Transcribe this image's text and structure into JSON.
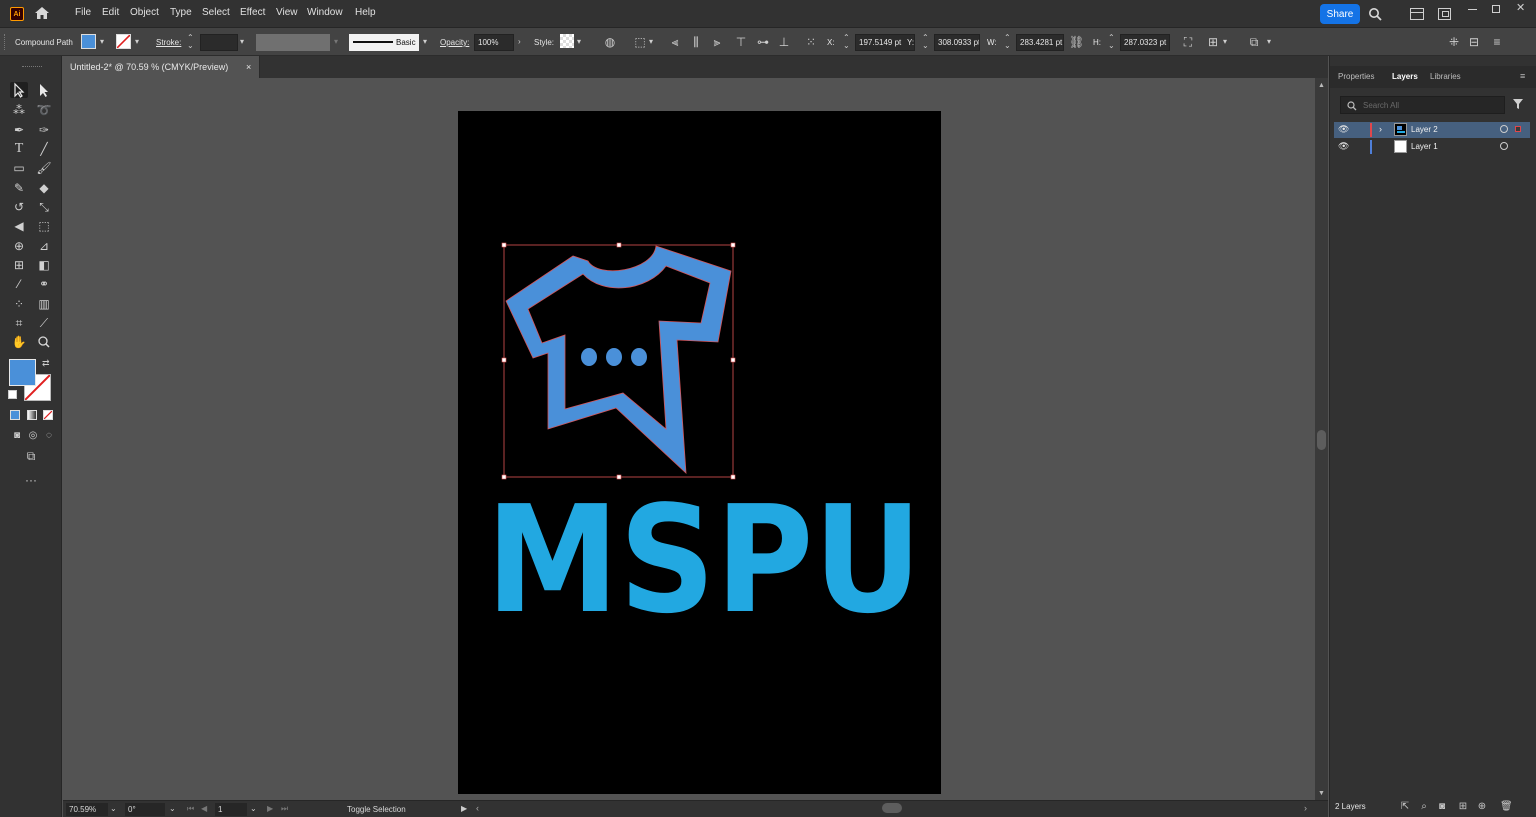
{
  "app": {
    "logo": "Ai"
  },
  "menu": [
    "File",
    "Edit",
    "Object",
    "Type",
    "Select",
    "Effect",
    "View",
    "Window",
    "Help"
  ],
  "topbar": {
    "share_label": "Share"
  },
  "control": {
    "selection_type": "Compound Path",
    "stroke_label": "Stroke:",
    "brush_label": "Basic",
    "opacity_label": "Opacity:",
    "opacity_value": "100%",
    "style_label": "Style:",
    "x_label": "X:",
    "x_value": "197.5149 pt",
    "y_label": "Y:",
    "y_value": "308.0933 pt",
    "w_label": "W:",
    "w_value": "283.4281 pt",
    "h_label": "H:",
    "h_value": "287.0323 pt",
    "fill_color": "#4a90d9"
  },
  "document": {
    "tab_title": "Untitled-2* @ 70.59 % (CMYK/Preview)",
    "close": "×"
  },
  "artwork": {
    "text": "MSPU",
    "text_color": "#22a8e1",
    "icon_color": "#4a90d9"
  },
  "status": {
    "zoom": "70.59%",
    "rotation": "0°",
    "artboard": "1",
    "tool_hint": "Toggle Selection"
  },
  "panel": {
    "tabs": [
      "Properties",
      "Layers",
      "Libraries"
    ],
    "search_placeholder": "Search All",
    "layers": [
      {
        "name": "Layer 2",
        "color": "#e0474c",
        "selected": true
      },
      {
        "name": "Layer 1",
        "color": "#4f7fd8",
        "selected": false
      }
    ],
    "layers_count": "2 Layers"
  }
}
